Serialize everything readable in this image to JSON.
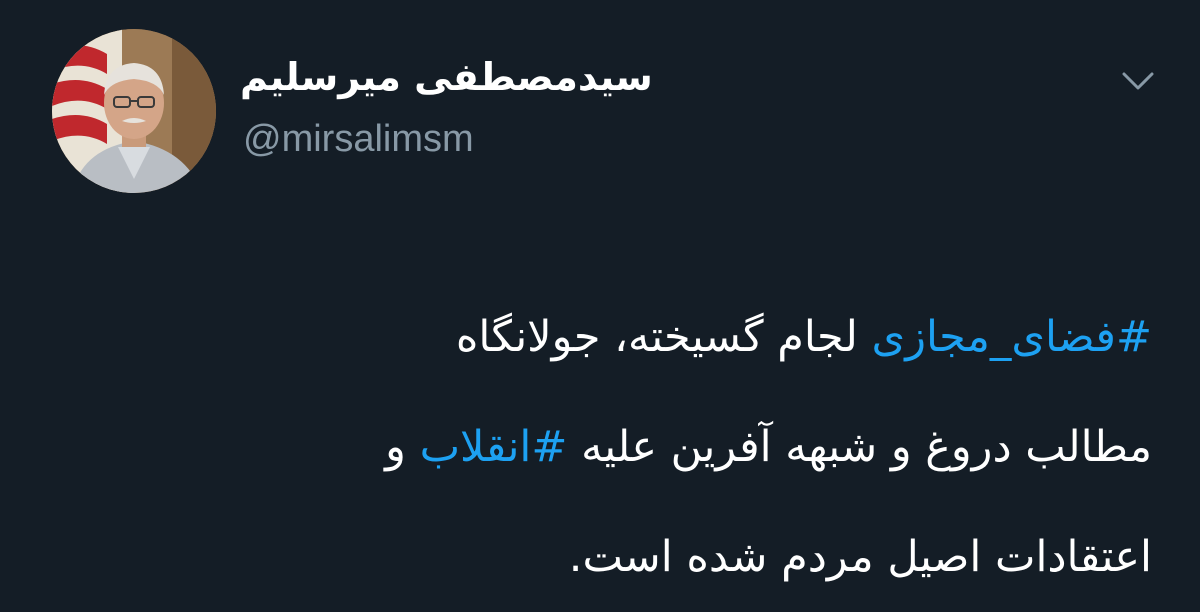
{
  "tweet": {
    "author": {
      "display_name": "سیدمصطفی میرسلیم",
      "handle": "@mirsalimsm"
    },
    "menu_icon": "chevron-down-icon",
    "body": {
      "line1": {
        "hashtag": "#فضای_مجازی",
        "text": " لجام گسیخته، جولانگاه"
      },
      "line2": {
        "text": "مطالب دروغ و شبهه آفرین علیه ",
        "hashtag": "#انقلاب",
        "text_after": " و"
      },
      "line3": {
        "text": "اعتقادات اصیل مردم شده است."
      }
    },
    "colors": {
      "background": "#141d26",
      "text": "#ffffff",
      "secondary_text": "#8899a6",
      "hashtag": "#1da1f2"
    }
  }
}
